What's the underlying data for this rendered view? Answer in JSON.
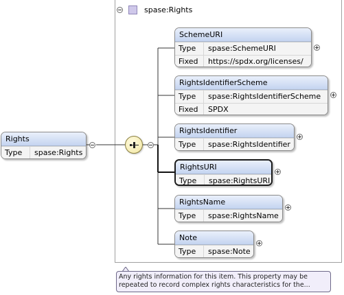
{
  "diagram": {
    "group": {
      "label": "spase:Rights"
    },
    "root": {
      "name": "Rights",
      "rows": [
        {
          "key": "Type",
          "value": "spase:Rights"
        }
      ]
    },
    "elements": [
      {
        "name": "SchemeURI",
        "rows": [
          {
            "key": "Type",
            "value": "spase:SchemeURI"
          },
          {
            "key": "Fixed",
            "value": "https://spdx.org/licenses/"
          }
        ]
      },
      {
        "name": "RightsIdentifierScheme",
        "rows": [
          {
            "key": "Type",
            "value": "spase:RightsIdentifierScheme"
          },
          {
            "key": "Fixed",
            "value": "SPDX"
          }
        ]
      },
      {
        "name": "RightsIdentifier",
        "rows": [
          {
            "key": "Type",
            "value": "spase:RightsIdentifier"
          }
        ]
      },
      {
        "name": "RightsURI",
        "rows": [
          {
            "key": "Type",
            "value": "spase:RightsURI"
          }
        ]
      },
      {
        "name": "RightsName",
        "rows": [
          {
            "key": "Type",
            "value": "spase:RightsName"
          }
        ]
      },
      {
        "name": "Note",
        "rows": [
          {
            "key": "Type",
            "value": "spase:Note"
          }
        ]
      }
    ],
    "tooltip": {
      "line1": "Any rights information for this item. This property may be",
      "line2": "repeated to record complex rights characteristics for the..."
    }
  }
}
